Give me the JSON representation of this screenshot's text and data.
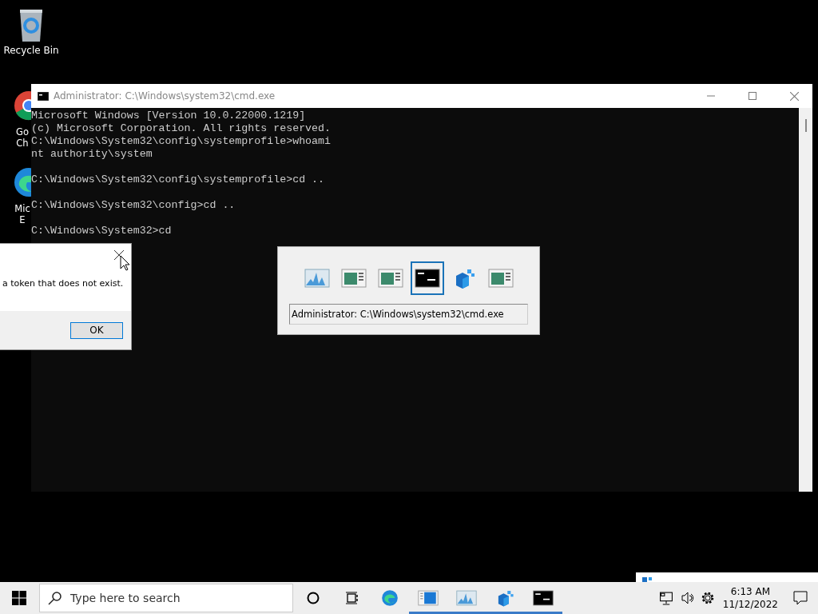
{
  "desktop_icons": [
    {
      "kind": "recycle",
      "lines": [
        "Recycle Bin"
      ]
    },
    {
      "kind": "chrome",
      "lines": [
        "Go",
        "Ch"
      ]
    },
    {
      "kind": "edge",
      "lines": [
        "Mic",
        "E"
      ]
    }
  ],
  "console_window": {
    "title": "Administrator: C:\\Windows\\system32\\cmd.exe",
    "lines": [
      {
        "text": "Microsoft Windows [Version 10.0.22000.1219]",
        "blank_before": false
      },
      {
        "text": "(c) Microsoft Corporation. All rights reserved.",
        "blank_before": false
      },
      {
        "text": "C:\\Windows\\System32\\config\\systemprofile>whoami",
        "blank_before": false
      },
      {
        "text": "nt authority\\system",
        "blank_before": false
      },
      {
        "text": "C:\\Windows\\System32\\config\\systemprofile>cd ..",
        "blank_before": true
      },
      {
        "text": "C:\\Windows\\System32\\config>cd ..",
        "blank_before": true
      },
      {
        "text": "C:\\Windows\\System32>cd",
        "blank_before": true
      }
    ]
  },
  "message_dialog": {
    "message": "a token that does not exist.",
    "button": "OK"
  },
  "task_switcher": {
    "items": [
      {
        "kind": "monitor",
        "selected": false
      },
      {
        "kind": "window",
        "selected": false
      },
      {
        "kind": "window",
        "selected": false
      },
      {
        "kind": "console",
        "selected": true
      },
      {
        "kind": "registry",
        "selected": false
      },
      {
        "kind": "window",
        "selected": false
      }
    ],
    "title": "Administrator: C:\\Windows\\system32\\cmd.exe"
  },
  "taskbar": {
    "search_placeholder": "Type here to search",
    "apps": [
      {
        "kind": "edge",
        "running": false
      },
      {
        "kind": "window",
        "running": true
      },
      {
        "kind": "monitor",
        "running": true
      },
      {
        "kind": "registry",
        "running": true
      },
      {
        "kind": "console",
        "running": true
      }
    ],
    "time": "6:13 AM",
    "date": "11/12/2022"
  }
}
